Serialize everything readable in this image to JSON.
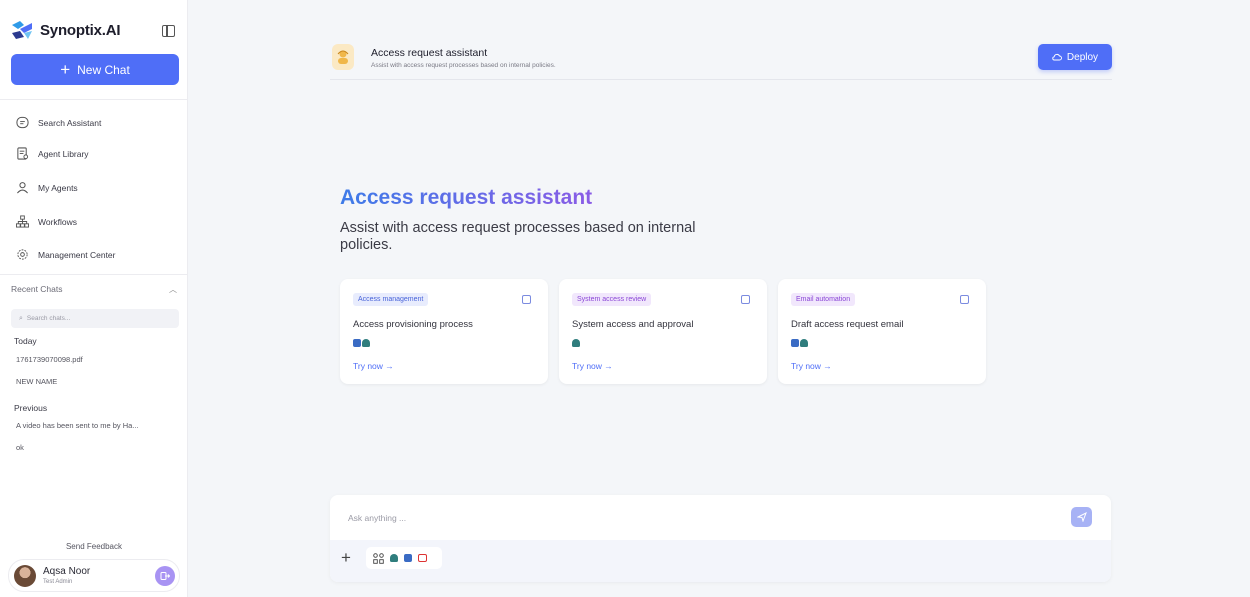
{
  "brand": {
    "name": "Synoptix.AI"
  },
  "sidebar": {
    "new_chat": "New Chat",
    "items": [
      {
        "label": "Search Assistant",
        "icon": "chat-search-icon"
      },
      {
        "label": "Agent Library",
        "icon": "library-icon"
      },
      {
        "label": "My Agents",
        "icon": "agents-icon"
      },
      {
        "label": "Workflows",
        "icon": "workflow-icon"
      },
      {
        "label": "Management Center",
        "icon": "gear-icon"
      }
    ],
    "recent_title": "Recent Chats",
    "search_placeholder": "Search chats...",
    "today_label": "Today",
    "today_chats": [
      "1761739070098.pdf",
      "NEW NAME"
    ],
    "previous_label": "Previous",
    "previous_chats": [
      "A video has been sent to me by Ha...",
      "ok"
    ],
    "feedback": "Send Feedback",
    "user": {
      "name": "Aqsa Noor",
      "role": "Test Admin"
    }
  },
  "header": {
    "title": "Access request assistant",
    "subtitle": "Assist with access request processes based on internal policies.",
    "deploy": "Deploy"
  },
  "hero": {
    "title": "Access request assistant",
    "subtitle": "Assist with access request processes based on internal policies."
  },
  "cards": [
    {
      "tag": "Access management",
      "title": "Access provisioning process",
      "try": "Try now →"
    },
    {
      "tag": "System access review",
      "title": "System access and approval",
      "try": "Try now →"
    },
    {
      "tag": "Email automation",
      "title": "Draft access request email",
      "try": "Try now →"
    }
  ],
  "composer": {
    "placeholder": "Ask anything ..."
  },
  "colors": {
    "accent": "#4f6ef7",
    "purple": "#8a5ce6"
  }
}
